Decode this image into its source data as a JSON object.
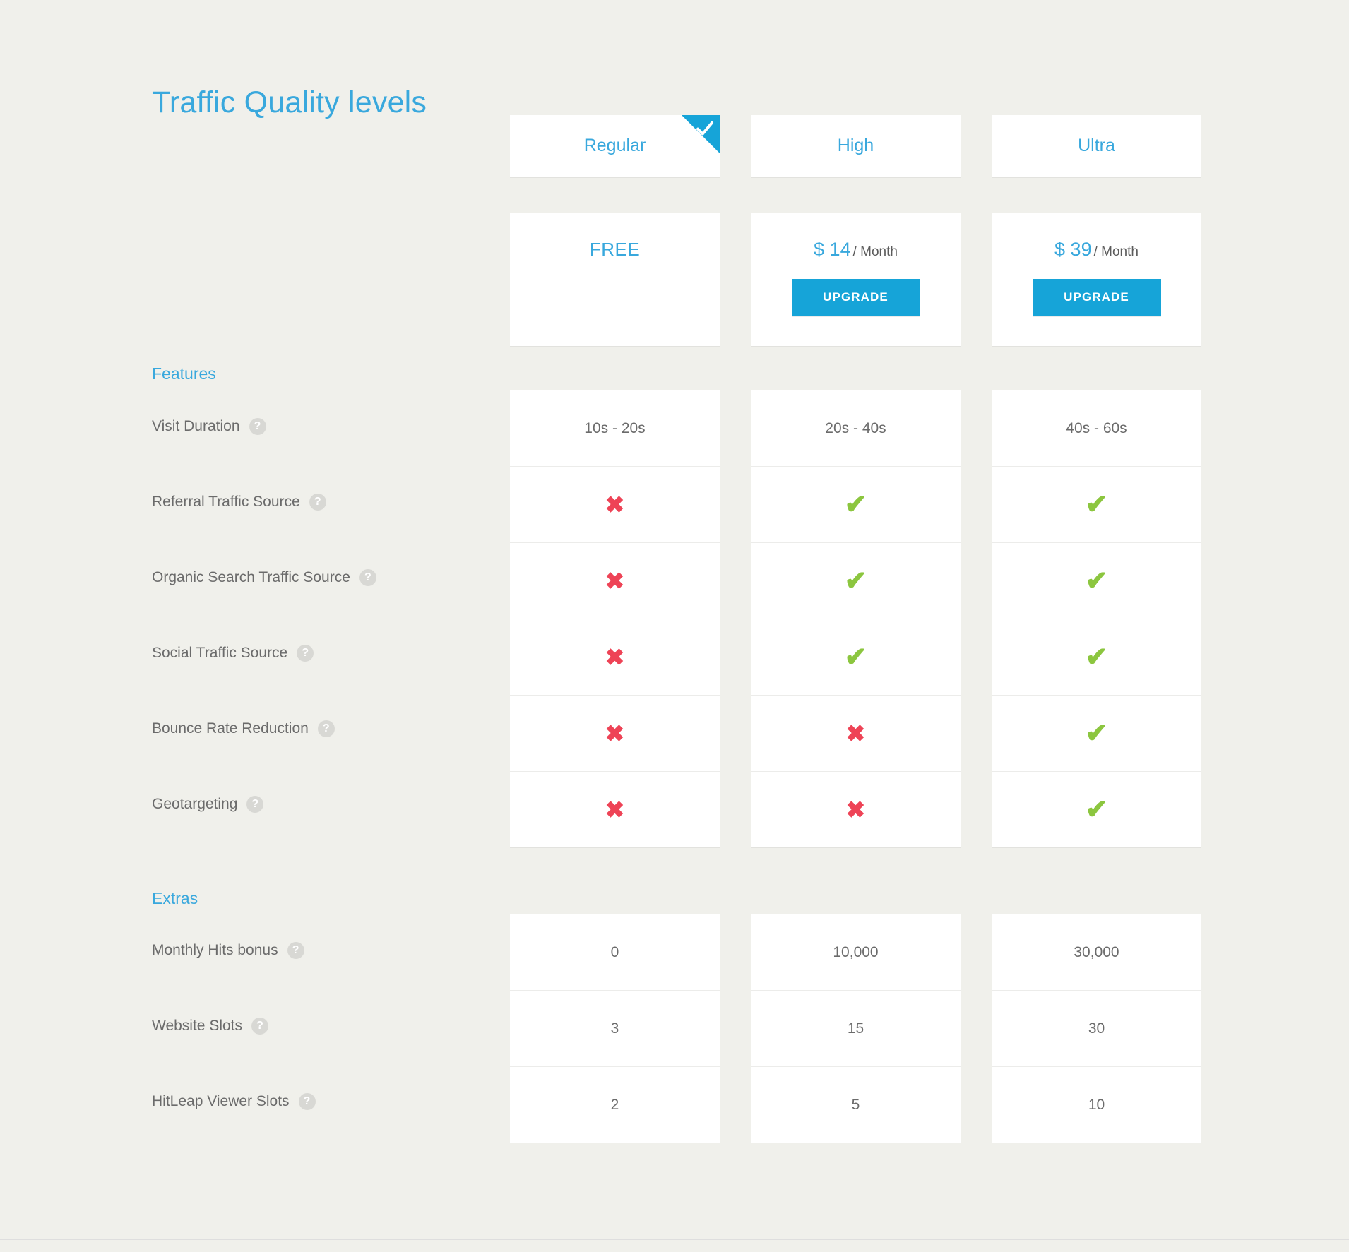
{
  "page": {
    "title": "Traffic Quality levels",
    "accent_color": "#39a8dd",
    "button_color": "#16a4d8",
    "background_color": "#f0f0eb",
    "yes_color": "#8cc63f",
    "no_color": "#ee4356"
  },
  "plans": [
    {
      "name": "Regular",
      "selected": true,
      "selected_icon": "check-icon",
      "price_display": "FREE",
      "price_amount": null,
      "price_period": null,
      "has_upgrade_button": false,
      "upgrade_label": null
    },
    {
      "name": "High",
      "selected": false,
      "selected_icon": null,
      "price_display": null,
      "price_amount": "$ 14",
      "price_period": "/ Month",
      "has_upgrade_button": true,
      "upgrade_label": "UPGRADE"
    },
    {
      "name": "Ultra",
      "selected": false,
      "selected_icon": null,
      "price_display": null,
      "price_amount": "$ 39",
      "price_period": "/ Month",
      "has_upgrade_button": true,
      "upgrade_label": "UPGRADE"
    }
  ],
  "sections": [
    {
      "heading": "Features",
      "rows": [
        {
          "label": "Visit Duration",
          "help_icon": "question-mark-icon",
          "values": [
            "10s - 20s",
            "20s - 40s",
            "40s - 60s"
          ],
          "kind": "text"
        },
        {
          "label": "Referral Traffic Source",
          "help_icon": "question-mark-icon",
          "values": [
            "no",
            "yes",
            "yes"
          ],
          "kind": "mark"
        },
        {
          "label": "Organic Search Traffic Source",
          "help_icon": "question-mark-icon",
          "values": [
            "no",
            "yes",
            "yes"
          ],
          "kind": "mark"
        },
        {
          "label": "Social Traffic Source",
          "help_icon": "question-mark-icon",
          "values": [
            "no",
            "yes",
            "yes"
          ],
          "kind": "mark"
        },
        {
          "label": "Bounce Rate Reduction",
          "help_icon": "question-mark-icon",
          "values": [
            "no",
            "no",
            "yes"
          ],
          "kind": "mark"
        },
        {
          "label": "Geotargeting",
          "help_icon": "question-mark-icon",
          "values": [
            "no",
            "no",
            "yes"
          ],
          "kind": "mark"
        }
      ]
    },
    {
      "heading": "Extras",
      "rows": [
        {
          "label": "Monthly Hits bonus",
          "help_icon": "question-mark-icon",
          "values": [
            "0",
            "10,000",
            "30,000"
          ],
          "kind": "text"
        },
        {
          "label": "Website Slots",
          "help_icon": "question-mark-icon",
          "values": [
            "3",
            "15",
            "30"
          ],
          "kind": "text"
        },
        {
          "label": "HitLeap Viewer Slots",
          "help_icon": "question-mark-icon",
          "values": [
            "2",
            "5",
            "10"
          ],
          "kind": "text"
        }
      ]
    }
  ],
  "glyphs": {
    "yes": "✔",
    "no": "✖",
    "help": "?"
  }
}
